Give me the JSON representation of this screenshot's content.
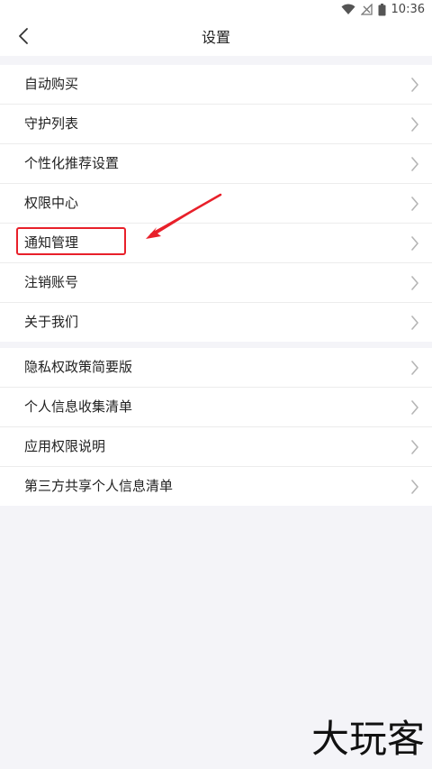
{
  "status_bar": {
    "time": "10:36",
    "icons": [
      "wifi-icon",
      "no-signal-icon",
      "battery-icon"
    ]
  },
  "header": {
    "title": "设置",
    "back_icon": "chevron-left-icon"
  },
  "groups": [
    {
      "items": [
        {
          "label": "自动购买"
        },
        {
          "label": "守护列表"
        },
        {
          "label": "个性化推荐设置"
        },
        {
          "label": "权限中心"
        },
        {
          "label": "通知管理"
        },
        {
          "label": "注销账号"
        },
        {
          "label": "关于我们"
        }
      ]
    },
    {
      "items": [
        {
          "label": "隐私权政策简要版"
        },
        {
          "label": "个人信息收集清单"
        },
        {
          "label": "应用权限说明"
        },
        {
          "label": "第三方共享个人信息清单"
        }
      ]
    }
  ],
  "annotation": {
    "highlight_color": "#e8202a",
    "highlighted_item": "通知管理"
  },
  "watermark": {
    "text": "大玩客"
  },
  "colors": {
    "background": "#f4f4f8",
    "surface": "#ffffff",
    "divider": "#ececec",
    "text": "#222222",
    "chevron": "#b5b5b5"
  }
}
